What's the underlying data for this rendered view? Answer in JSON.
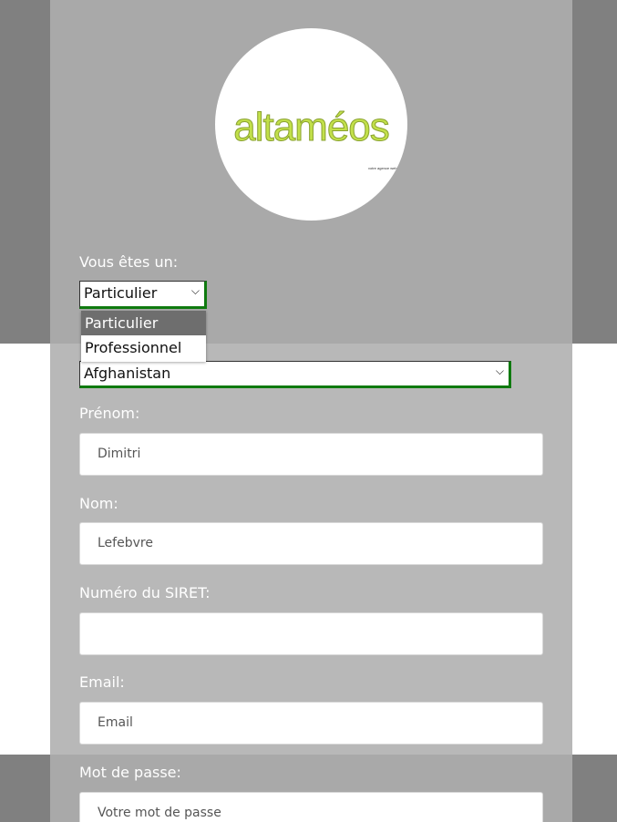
{
  "logo": {
    "word": "altaméos",
    "tagline": "votre agence web"
  },
  "form": {
    "type_label": "Vous êtes un:",
    "type_select_value": "Particulier",
    "type_options": [
      "Particulier",
      "Professionnel"
    ],
    "country_select_value": "Afghanistan",
    "prenom_label": "Prénom:",
    "prenom_placeholder": "Dimitri",
    "nom_label": "Nom:",
    "nom_placeholder": "Lefebvre",
    "siret_label": "Numéro du SIRET:",
    "siret_placeholder": "",
    "email_label": "Email:",
    "email_placeholder": "Email",
    "password_label": "Mot de passe:",
    "password_placeholder": "Votre mot de passe"
  },
  "colors": {
    "accent_border": "#0f7a0f",
    "logo_green": "#c2e04a",
    "page_dark": "#808080"
  }
}
